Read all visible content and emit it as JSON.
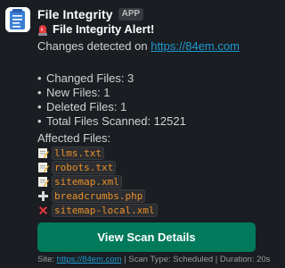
{
  "app": {
    "name": "File Integrity",
    "badge": "APP",
    "avatar_icon": "clipboard-document-icon"
  },
  "message": {
    "alert_icon": "rotating-light-icon",
    "alert_title": "File Integrity Alert!",
    "changes_prefix": "Changes detected on ",
    "site_link": "https://84em.com",
    "stats": [
      {
        "label": "Changed Files: 3"
      },
      {
        "label": "New Files: 1"
      },
      {
        "label": "Deleted Files: 1"
      },
      {
        "label": "Total Files Scanned: 12521"
      }
    ],
    "affected_title": "Affected Files:",
    "files": [
      {
        "name": "llms.txt",
        "status_icon": "memo-icon"
      },
      {
        "name": "robots.txt",
        "status_icon": "memo-icon"
      },
      {
        "name": "sitemap.xml",
        "status_icon": "memo-icon"
      },
      {
        "name": "breadcrumbs.php",
        "status_icon": "plus-icon"
      },
      {
        "name": "sitemap-local.xml",
        "status_icon": "cross-mark-icon"
      }
    ]
  },
  "button": {
    "label": "View Scan Details"
  },
  "footer": {
    "site_prefix": "Site: ",
    "site_link": "https://84em.com",
    "scan_type": " | Scan Type: Scheduled | Duration: 20s"
  },
  "colors": {
    "background": "#1a1d21",
    "link": "#1d9bd1",
    "button": "#007a5a",
    "code_text": "#e8912d"
  }
}
